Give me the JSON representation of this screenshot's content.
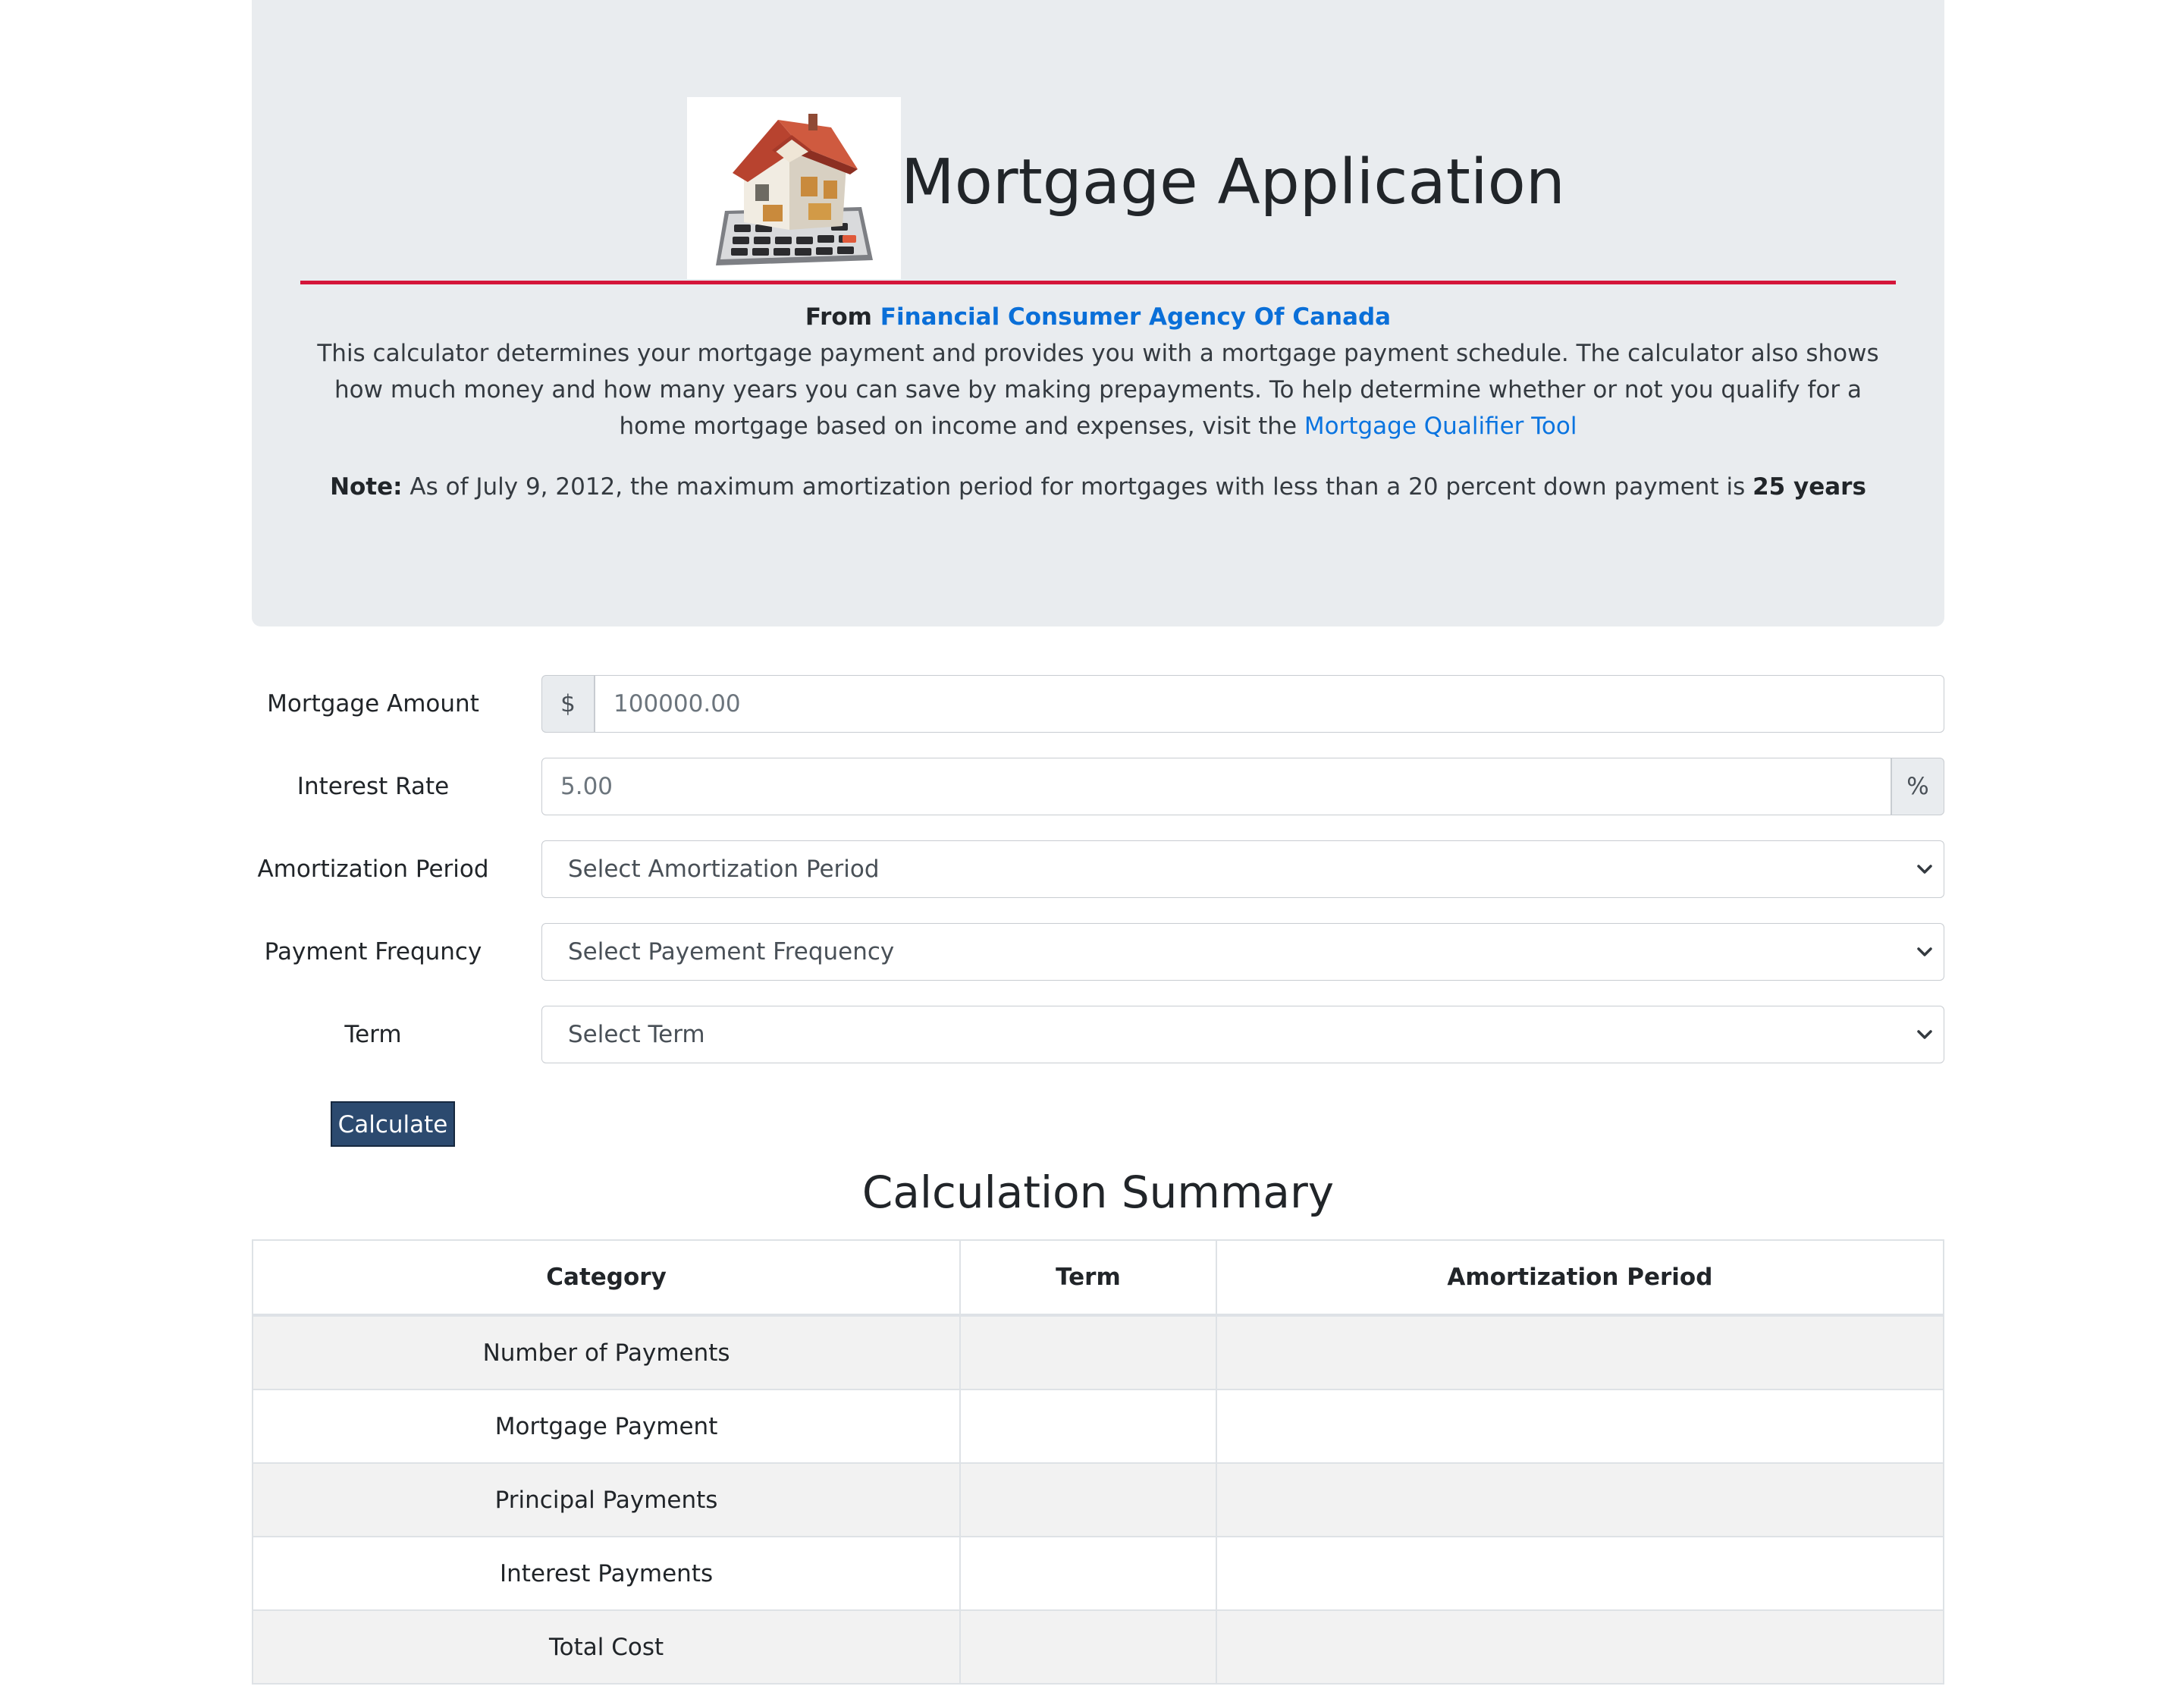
{
  "header": {
    "title": "Mortgage Application",
    "logo_icon": "house-calculator-icon",
    "from_prefix": "From",
    "from_link": "Financial Consumer Agency Of Canada",
    "description": "This calculator determines your mortgage payment and provides you with a mortgage payment schedule. The calculator also shows how much money and how many years you can save by making prepayments. To help determine whether or not you qualify for a home mortgage based on income and expenses, visit the",
    "qualifier_link": "Mortgage Qualifier Tool",
    "note_label": "Note:",
    "note_text": "As of July 9, 2012, the maximum amortization period for mortgages with less than a 20 percent down payment is",
    "note_emphasis": "25 years",
    "accent_color": "#d4153a",
    "link_color": "#0a6fd8"
  },
  "form": {
    "mortgage_amount": {
      "label": "Mortgage Amount",
      "prefix": "$",
      "value": "100000.00"
    },
    "interest_rate": {
      "label": "Interest Rate",
      "value": "5.00",
      "suffix": "%"
    },
    "amortization": {
      "label": "Amortization Period",
      "selected": "Select Amortization Period"
    },
    "frequency": {
      "label": "Payment Frequncy",
      "selected": "Select Payement Frequency"
    },
    "term": {
      "label": "Term",
      "selected": "Select Term"
    },
    "calculate_label": "Calculate",
    "button_color": "#2c4a6f"
  },
  "summary": {
    "title": "Calculation Summary",
    "columns": [
      "Category",
      "Term",
      "Amortization Period"
    ],
    "rows": [
      {
        "category": "Number of Payments",
        "term": "",
        "amortization": ""
      },
      {
        "category": "Mortgage Payment",
        "term": "",
        "amortization": ""
      },
      {
        "category": "Principal Payments",
        "term": "",
        "amortization": ""
      },
      {
        "category": "Interest Payments",
        "term": "",
        "amortization": ""
      },
      {
        "category": "Total Cost",
        "term": "",
        "amortization": ""
      }
    ]
  }
}
